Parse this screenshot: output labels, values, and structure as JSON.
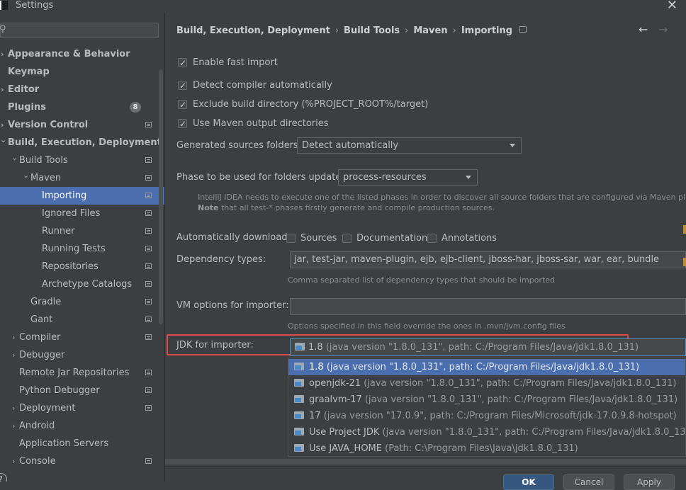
{
  "window": {
    "title": "Settings",
    "close_glyph": "✕"
  },
  "search": {
    "value": "",
    "placeholder": ""
  },
  "sidebar": {
    "items": [
      {
        "label": "Appearance & Behavior",
        "indent": 0,
        "bold": true,
        "arrow": "›",
        "selected": false,
        "settings_icon": false
      },
      {
        "label": "Keymap",
        "indent": 0,
        "bold": true,
        "arrow": "",
        "selected": false,
        "settings_icon": false
      },
      {
        "label": "Editor",
        "indent": 0,
        "bold": true,
        "arrow": "›",
        "selected": false,
        "settings_icon": false
      },
      {
        "label": "Plugins",
        "indent": 0,
        "bold": true,
        "arrow": "",
        "selected": false,
        "settings_icon": false,
        "badge": "8"
      },
      {
        "label": "Version Control",
        "indent": 0,
        "bold": true,
        "arrow": "›",
        "selected": false,
        "settings_icon": true
      },
      {
        "label": "Build, Execution, Deployment",
        "indent": 0,
        "bold": true,
        "arrow": "⌄",
        "selected": false,
        "settings_icon": false
      },
      {
        "label": "Build Tools",
        "indent": 1,
        "bold": false,
        "arrow": "⌄",
        "selected": false,
        "settings_icon": true
      },
      {
        "label": "Maven",
        "indent": 2,
        "bold": false,
        "arrow": "⌄",
        "selected": false,
        "settings_icon": true
      },
      {
        "label": "Importing",
        "indent": 3,
        "bold": false,
        "arrow": "",
        "selected": true,
        "settings_icon": true
      },
      {
        "label": "Ignored Files",
        "indent": 3,
        "bold": false,
        "arrow": "",
        "selected": false,
        "settings_icon": true
      },
      {
        "label": "Runner",
        "indent": 3,
        "bold": false,
        "arrow": "",
        "selected": false,
        "settings_icon": true
      },
      {
        "label": "Running Tests",
        "indent": 3,
        "bold": false,
        "arrow": "",
        "selected": false,
        "settings_icon": true
      },
      {
        "label": "Repositories",
        "indent": 3,
        "bold": false,
        "arrow": "",
        "selected": false,
        "settings_icon": true
      },
      {
        "label": "Archetype Catalogs",
        "indent": 3,
        "bold": false,
        "arrow": "",
        "selected": false,
        "settings_icon": true
      },
      {
        "label": "Gradle",
        "indent": 2,
        "bold": false,
        "arrow": "",
        "selected": false,
        "settings_icon": true
      },
      {
        "label": "Gant",
        "indent": 2,
        "bold": false,
        "arrow": "",
        "selected": false,
        "settings_icon": true
      },
      {
        "label": "Compiler",
        "indent": 1,
        "bold": false,
        "arrow": "›",
        "selected": false,
        "settings_icon": true
      },
      {
        "label": "Debugger",
        "indent": 1,
        "bold": false,
        "arrow": "›",
        "selected": false,
        "settings_icon": false
      },
      {
        "label": "Remote Jar Repositories",
        "indent": 1,
        "bold": false,
        "arrow": "",
        "selected": false,
        "settings_icon": true
      },
      {
        "label": "Python Debugger",
        "indent": 1,
        "bold": false,
        "arrow": "",
        "selected": false,
        "settings_icon": true
      },
      {
        "label": "Deployment",
        "indent": 1,
        "bold": false,
        "arrow": "›",
        "selected": false,
        "settings_icon": true
      },
      {
        "label": "Android",
        "indent": 1,
        "bold": false,
        "arrow": "›",
        "selected": false,
        "settings_icon": false
      },
      {
        "label": "Application Servers",
        "indent": 1,
        "bold": false,
        "arrow": "",
        "selected": false,
        "settings_icon": false
      },
      {
        "label": "Console",
        "indent": 1,
        "bold": false,
        "arrow": "›",
        "selected": false,
        "settings_icon": true
      }
    ]
  },
  "breadcrumb": [
    "Build, Execution, Deployment",
    "Build Tools",
    "Maven",
    "Importing"
  ],
  "breadcrumb_sep": "›",
  "nav": {
    "back": "←",
    "forward": "→"
  },
  "options": {
    "enable_fast_import": {
      "label": "Enable fast import",
      "checked": true
    },
    "detect_compiler": {
      "label": "Detect compiler automatically",
      "checked": true
    },
    "exclude_build_dir": {
      "label": "Exclude build directory (%PROJECT_ROOT%/target)",
      "checked": true
    },
    "use_output_dirs": {
      "label": "Use Maven output directories",
      "checked": true
    }
  },
  "generated_sources": {
    "label": "Generated sources folders:",
    "value": "Detect automatically"
  },
  "phase": {
    "label": "Phase to be used for folders update:",
    "value": "process-resources",
    "note_line1": "IntelliJ IDEA needs to execute one of the listed phases in order to discover all source folders that are configured via Maven plugins.",
    "note_bold": "Note",
    "note_line2_rest": " that all test-* phases firstly generate and compile production sources."
  },
  "auto_download": {
    "label": "Automatically download:",
    "sources": {
      "label": "Sources",
      "checked": false
    },
    "documentation": {
      "label": "Documentation",
      "checked": false
    },
    "annotations": {
      "label": "Annotations",
      "checked": false
    }
  },
  "dependency_types": {
    "label": "Dependency types:",
    "value": "jar, test-jar, maven-plugin, ejb, ejb-client, jboss-har, jboss-sar, war, ear, bundle",
    "hint": "Comma separated list of dependency types that should be imported"
  },
  "vm_options": {
    "label": "VM options for importer:",
    "value": "",
    "hint": "Options specified in this field override the ones in .mvn/jvm.config files"
  },
  "jdk": {
    "label": "JDK for importer:",
    "selected_name": "1.8",
    "selected_detail": "(java version \"1.8.0_131\", path: C:/Program Files/Java/jdk1.8.0_131)",
    "options": [
      {
        "name": "1.8",
        "detail": "(java version \"1.8.0_131\", path: C:/Program Files/Java/jdk1.8.0_131)",
        "selected": true
      },
      {
        "name": "openjdk-21",
        "detail": "(java version \"1.8.0_131\", path: C:/Program Files/Java/jdk1.8.0_131)",
        "selected": false
      },
      {
        "name": "graalvm-17",
        "detail": "(java version \"1.8.0_131\", path: C:/Program Files/Java/jdk1.8.0_131)",
        "selected": false
      },
      {
        "name": "17",
        "detail": "(java version \"17.0.9\", path: C:/Program Files/Microsoft/jdk-17.0.9.8-hotspot)",
        "selected": false
      },
      {
        "name": "Use Project JDK",
        "detail": "(java version \"1.8.0_131\", path: C:/Program Files/Java/jdk1.8.0_131)",
        "selected": false
      },
      {
        "name": "Use JAVA_HOME",
        "detail": "(Path: C:\\Program Files\\Java\\jdk1.8.0_131)",
        "selected": false
      }
    ]
  },
  "buttons": {
    "ok": "OK",
    "cancel": "Cancel",
    "apply": "Apply"
  },
  "colors": {
    "selection": "#4b6eaf",
    "highlight_border": "#e04b4b",
    "focus_border": "#5592c5"
  }
}
